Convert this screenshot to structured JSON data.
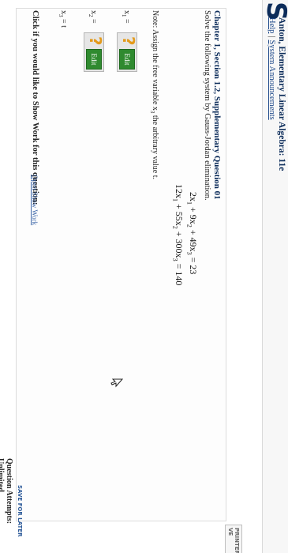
{
  "header": {
    "logo_letter": "S",
    "course_title": "Anton, Elementary Linear Algebra: 11e",
    "links": [
      "Help",
      "System Announcements"
    ],
    "separator": "|"
  },
  "printer_label": "PRINTER VE",
  "question": {
    "title": "Chapter 1, Section 1.2, Supplementary Question 01",
    "instruction": "Solve the following system by Gauss-Jordan elimination.",
    "equation1": {
      "c1": "2x",
      "s1": "1",
      "t2": " + 9x",
      "s2": "2",
      "t3": " + 49x",
      "s3": "3",
      "rhs": " = 23"
    },
    "equation2": {
      "c1": "12x",
      "s1": "1",
      "t2": " + 55x",
      "s2": "2",
      "t3": " + 300x",
      "s3": "3",
      "rhs": " = 140"
    },
    "note_prefix": "Note: Assign the free variable x",
    "note_sub": "3",
    "note_suffix": " the arbitrary value t.",
    "vars": [
      {
        "name": "x",
        "sub": "1",
        "eq": " = "
      },
      {
        "name": "x",
        "sub": "2",
        "eq": " = "
      }
    ],
    "placeholder_glyph": "?",
    "edit_label": "Edit",
    "x3": {
      "name": "x",
      "sub": "3",
      "value": " = t"
    },
    "show_work_prompt": "Click if you would like to Show Work for this question:",
    "show_work_link": "Open Show Work"
  },
  "footer": {
    "attempts": "Question Attempts: Unlimited",
    "save_later": "SAVE FOR LATER"
  }
}
